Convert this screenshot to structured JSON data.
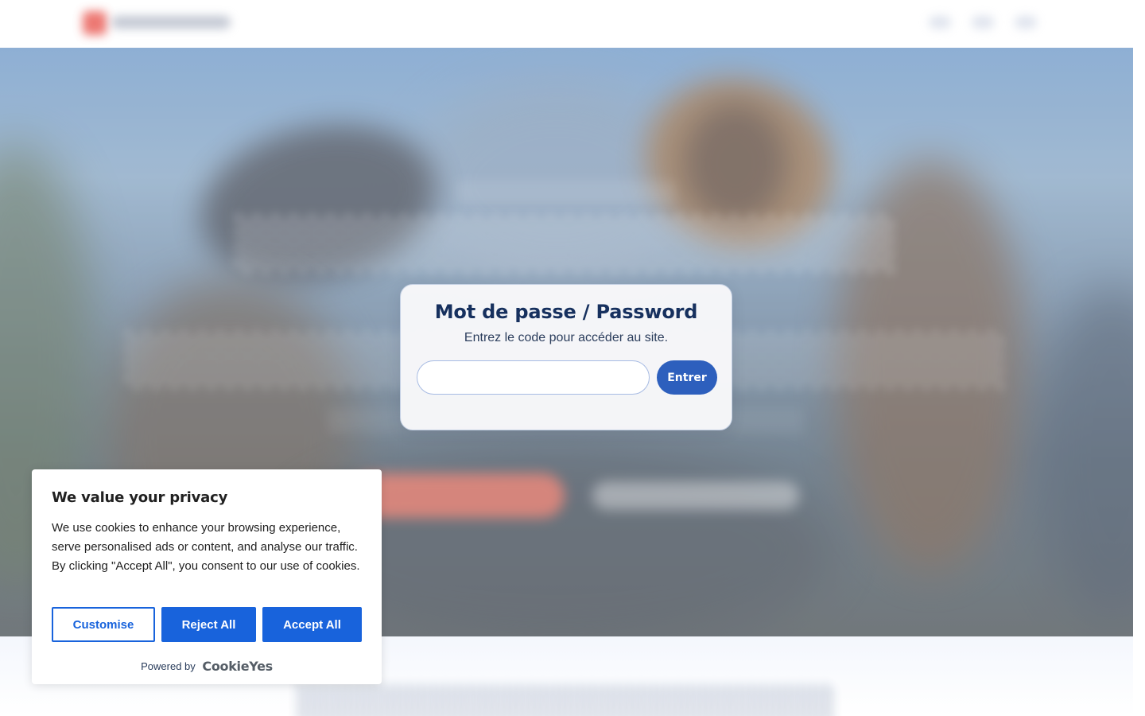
{
  "password_modal": {
    "title": "Mot de passe / Password",
    "subtitle": "Entrez le code pour accéder au site.",
    "input_value": "",
    "submit_label": "Entrer"
  },
  "cookie_banner": {
    "title": "We value your privacy",
    "text": "We use cookies to enhance your browsing experience, serve personalised ads or content, and analyse our traffic. By clicking \"Accept All\", you consent to our use of cookies.",
    "customise_label": "Customise",
    "reject_label": "Reject All",
    "accept_label": "Accept All",
    "powered_by": "Powered by",
    "brand": "CookieYes"
  },
  "colors": {
    "modal_title": "#16305e",
    "primary_button": "#2d5fbd",
    "cookie_accent": "#1863dc"
  }
}
